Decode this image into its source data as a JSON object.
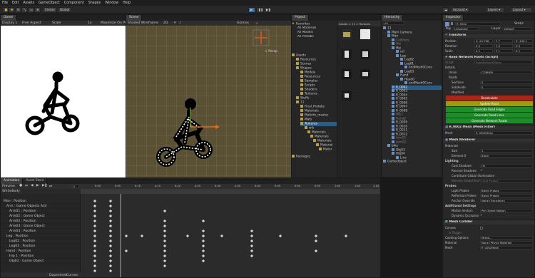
{
  "menu": [
    "File",
    "Edit",
    "Assets",
    "GameObject",
    "Component",
    "Shapes",
    "Window",
    "Help"
  ],
  "toolbar": {
    "pivot": "Center",
    "space": "Global",
    "layers": "Layers",
    "layout": "Layout",
    "account": "Account"
  },
  "game": {
    "tab": "Game",
    "display": "Display 1",
    "aspect": "Free Aspect",
    "scale_label": "Scale",
    "scale_value": "1x",
    "maximize": "Maximize On Pl"
  },
  "scene": {
    "tab": "Scene",
    "shading": "Shaded Wireframe",
    "mode": "2D",
    "gizmos": "Gizmos",
    "persp": "< Persp"
  },
  "project": {
    "tab": "Project",
    "favorites": "Favorites",
    "fav_items": [
      "All Materials",
      "All Models",
      "All Prefabs"
    ],
    "assets": "Assets",
    "tree": [
      "Resources",
      "Scenes",
      "Shapes",
      "Models",
      "Resources",
      "Samples",
      "Scripts",
      "Shaders",
      "Textures",
      "Stuffs",
      "11",
      "Final_Prefabs",
      "Materials",
      "Matinfo_master",
      "Mats",
      "Textures",
      "wfs",
      "Materials",
      "Materials",
      "Materials",
      "Material",
      "Mater"
    ],
    "packages": "Packages",
    "breadcrumb": "Assets > 11 > Textures",
    "thumbs": [
      "",
      "",
      "",
      "",
      "",
      "",
      "",
      ""
    ]
  },
  "hierarchy": {
    "tab": "Hierarchy",
    "search": "All",
    "items": [
      "11",
      "Main Camera",
      "Man",
      "Colliders",
      "Hip",
      "Hip",
      "ref",
      "Leg",
      "Leg02",
      "Leg01",
      "endMesh0Cons",
      "Leg03",
      "Hand",
      "Head0",
      "endMesh0Cons",
      "R_0002",
      "R_0003",
      "R_0004",
      "R_0005",
      "R_0006",
      "R_0007",
      "R_0008",
      "Hip1",
      "Hand2",
      "R_0009",
      "R_0010",
      "R_0011",
      "R_0012",
      "Arm01",
      "Arm02",
      "bike",
      "Obj03",
      "Obj04",
      "Line",
      "GameObject"
    ]
  },
  "inspector": {
    "tab": "Inspector",
    "object_name": "R_0002",
    "static_label": "Static",
    "tag_label": "Tag",
    "tag_value": "Untagged",
    "layer_label": "Layer",
    "layer_value": "Default",
    "transform": "Transform",
    "position_label": "Position",
    "position": [
      "X -25.798",
      "Y 7",
      "Z -349.1"
    ],
    "rotation_label": "Rotation",
    "rotation": [
      "X 0",
      "Y 0",
      "Z 0"
    ],
    "scale_label": "Scale",
    "scale": [
      "X 1",
      "Y 1",
      "Z 1"
    ],
    "script_component": "Road Network Roots (Script)",
    "script_label": "Script",
    "script_value": "RoadNetworkRoots",
    "details": "Details",
    "union_label": "Union",
    "union_value": "CORNER",
    "roads": "Roads",
    "sections_label": "Sections",
    "sections_value": "5",
    "subdivide_label": "Subdivide",
    "subdivide_value": "5",
    "modified_label": "Modified",
    "buttons": [
      "Recalculate",
      "Update Road",
      "Generate Road Edges",
      "Generate Road Lines",
      "Generate Network Roads"
    ],
    "button_colors": [
      "#a8271d",
      "#9e9a18",
      "#1f8c2b",
      "#1f8c2b",
      "#1f8c2b"
    ],
    "mesh_filter": "R_0002 Mesh (Mesh Filter)",
    "mesh_label": "Mesh",
    "mesh_value": "R_0002Mesh",
    "mesh_renderer": "Mesh Renderer",
    "materials_label": "Materials",
    "size_label": "Size",
    "size_value": "1",
    "element_label": "Element 0",
    "element_value": "Black",
    "lighting": "Lighting",
    "cast_shadows_label": "Cast Shadows",
    "cast_shadows_value": "On",
    "receive_shadows_label": "Receive Shadows",
    "contribute_gi_label": "Contribute Global Illumination",
    "receive_gi_label": "Receive Global Illumination",
    "receive_gi_value": "Light Probes",
    "probes": "Probes",
    "light_probes_label": "Light Probes",
    "light_probes_value": "Blend Probes",
    "reflection_probes_label": "Reflection Probes",
    "reflection_probes_value": "Blend Probes",
    "anchor_label": "Anchor Override",
    "anchor_value": "None (Transform)",
    "additional": "Additional Settings",
    "motion_vectors_label": "Motion Vectors",
    "motion_vectors_value": "Per Object Motion",
    "dynamic_occlusion_label": "Dynamic Occlusion",
    "mesh_collider": "Mesh Collider",
    "convex_label": "Convex",
    "trigger_label": "Is Trigger",
    "cooking_label": "Cooking Options",
    "cooking_value": "Mixed...",
    "material_label": "Material",
    "material_value": "None (Physic Material)",
    "mesh2_label": "Mesh",
    "mesh2_value": "R_0002Mesh"
  },
  "animation": {
    "tabs": [
      "Animation",
      "Asset Store"
    ],
    "preview": "Preview",
    "frame": "0",
    "clip": "WhiteBody",
    "tracks": [
      "Man : Position",
      "Arm : Game Objects Acti",
      "Arm01 : Position",
      "Arm02 : Game Object",
      "Arm02 : Position",
      "Arm03 : Game Object",
      "Arm03 : Position",
      "Leg : Position",
      "Leg02 : Position",
      "Leg03 : Position",
      "Hand : Position",
      "Hip 1 : Position",
      "Obj03 : Game Object"
    ],
    "bottom_tabs": [
      "Dopesheet",
      "Curves"
    ],
    "ruler": [
      "0:00",
      "0:05",
      "0:10",
      "0:15",
      "0:20",
      "0:25",
      "0:30",
      "0:35",
      "0:40",
      "0:45",
      "0:50",
      "0:55",
      "1:00",
      "1:05",
      "1:10"
    ]
  }
}
